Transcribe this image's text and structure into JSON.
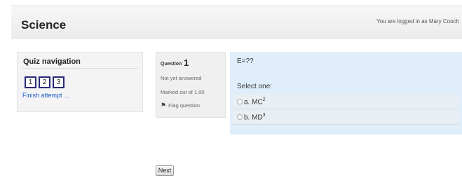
{
  "header": {
    "course_title": "Science",
    "login_text": "You are logged in as Mary Cooch"
  },
  "quiz_nav": {
    "title": "Quiz navigation",
    "question_buttons": [
      "1",
      "2",
      "3"
    ],
    "finish_link": "Finish attempt ..."
  },
  "question_info": {
    "label": "Question",
    "number": "1",
    "state": "Not yet answered",
    "marked_out_of": "Marked out of 1.00",
    "flag_label": "Flag question",
    "flag_icon": "flag-icon"
  },
  "question": {
    "text": "E=??",
    "select_label": "Select one:",
    "answers": [
      {
        "prefix": "a. MC",
        "sup": "2"
      },
      {
        "prefix": "b. MD",
        "sup": "3"
      }
    ]
  },
  "nav": {
    "next_label": "Next"
  }
}
